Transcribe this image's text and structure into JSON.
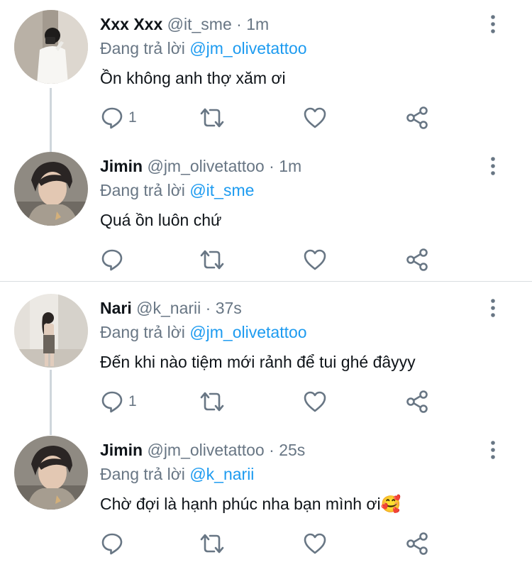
{
  "tweets": [
    {
      "name": "Xxx Xxx",
      "handle": "@it_sme",
      "separator": "·",
      "time": "1m",
      "replying_prefix": "Đang trả lời",
      "replying_to": "@jm_olivetattoo",
      "text": "Ồn không anh thợ xăm ơi",
      "reply_count": "1",
      "avatar": "mirror-selfie-photo"
    },
    {
      "name": "Jimin",
      "handle": "@jm_olivetattoo",
      "separator": "·",
      "time": "1m",
      "replying_prefix": "Đang trả lời",
      "replying_to": "@it_sme",
      "text": "Quá ồn luôn chứ",
      "reply_count": "",
      "avatar": "portrait-photo"
    },
    {
      "name": "Nari",
      "handle": "@k_narii",
      "separator": "·",
      "time": "37s",
      "replying_prefix": "Đang trả lời",
      "replying_to": "@jm_olivetattoo",
      "text": "Đến khi nào tiệm mới rảnh để tui ghé đâyyy",
      "reply_count": "1",
      "avatar": "full-body-photo"
    },
    {
      "name": "Jimin",
      "handle": "@jm_olivetattoo",
      "separator": "·",
      "time": "25s",
      "replying_prefix": "Đang trả lời",
      "replying_to": "@k_narii",
      "text": "Chờ đợi là hạnh phúc nha bạn mình ơi🥰",
      "reply_count": "",
      "avatar": "portrait-photo"
    }
  ],
  "icons": {
    "reply": "reply-icon",
    "retweet": "retweet-icon",
    "like": "like-icon",
    "share": "share-icon",
    "more": "more-icon"
  },
  "colors": {
    "mention": "#1d9bf0",
    "secondary_text": "#687684",
    "connector": "#cfd6dc"
  }
}
